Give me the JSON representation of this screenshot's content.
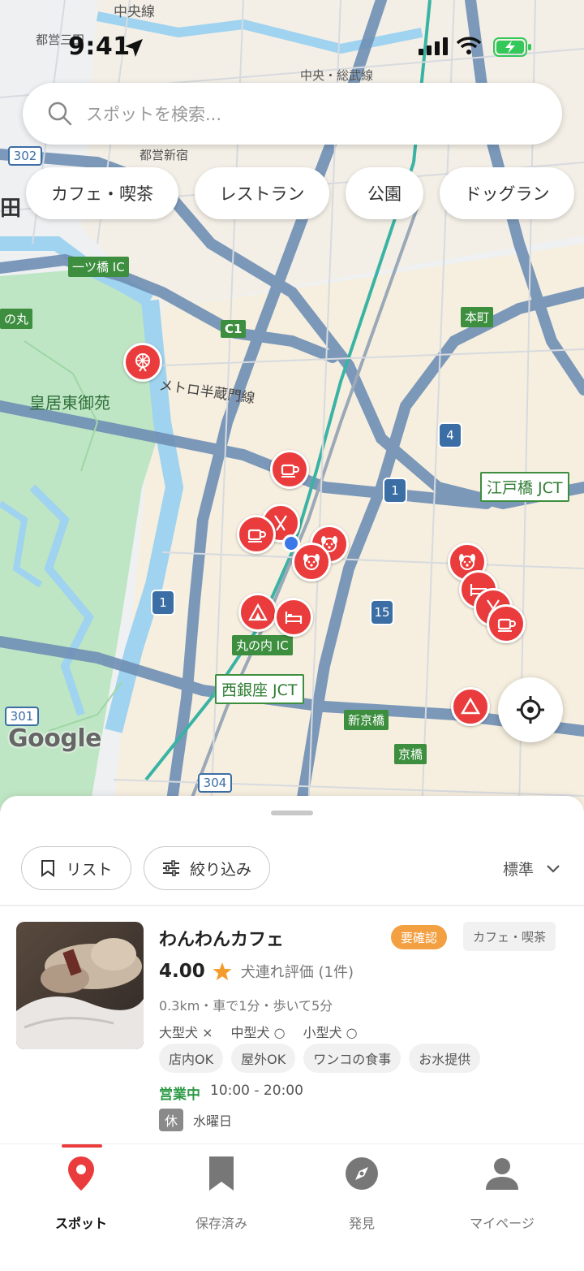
{
  "status_bar": {
    "time": "9:41"
  },
  "search": {
    "placeholder": "スポットを検索..."
  },
  "category_chips": [
    "カフェ・喫茶",
    "レストラン",
    "公園",
    "ドッグラン"
  ],
  "map": {
    "labels": {
      "chuo_sen": "中央線",
      "toei_mita": "都営三田",
      "chuo_sobu": "中央・総武線",
      "toei_shinjuku": "都営新宿",
      "hitotsubashi_ic": "一ツ橋 IC",
      "no_maru": "の丸",
      "c1": "C1",
      "honcho": "本町",
      "kokyo_higashi_gyoen": "皇居東御苑",
      "hanzomon_line": "メトロ半蔵門線",
      "edobashi_jct": "江戸橋 JCT",
      "marunouchi_ic": "丸の内 IC",
      "nishiginza_jct": "西銀座 JCT",
      "shin_kyobashi": "新京橋",
      "kyobashi": "京橋",
      "google": "Google",
      "kanda_fragment": "田"
    },
    "road_shields": [
      "302",
      "4",
      "1",
      "1",
      "15",
      "301",
      "304"
    ]
  },
  "sheet": {
    "list_button": "リスト",
    "filter_button": "絞り込み",
    "sort_label": "標準"
  },
  "spot": {
    "name": "わんわんカフェ",
    "status_badge": "要確認",
    "category": "カフェ・喫茶",
    "rating": "4.00",
    "rating_label": "犬連れ評価 (1件)",
    "distance": "0.3km・車で1分・歩いて5分",
    "dog_sizes": [
      "大型犬 ×",
      "中型犬 ○",
      "小型犬 ○"
    ],
    "tags": [
      "店内OK",
      "屋外OK",
      "ワンコの食事",
      "お水提供"
    ],
    "open_status": "営業中",
    "hours": "10:00 - 20:00",
    "closed_badge": "休",
    "closed_day": "水曜日"
  },
  "tabs": [
    {
      "label": "スポット",
      "icon": "map-pin-icon",
      "active": true
    },
    {
      "label": "保存済み",
      "icon": "bookmark-icon",
      "active": false
    },
    {
      "label": "発見",
      "icon": "compass-icon",
      "active": false
    },
    {
      "label": "マイページ",
      "icon": "person-icon",
      "active": false
    }
  ],
  "colors": {
    "accent": "#ea3c3c",
    "open_green": "#2e9b47",
    "warn_orange": "#f3a043",
    "map_park": "#bfe6c4",
    "map_water": "#9fd3ef",
    "map_highway": "#5d84b0"
  }
}
